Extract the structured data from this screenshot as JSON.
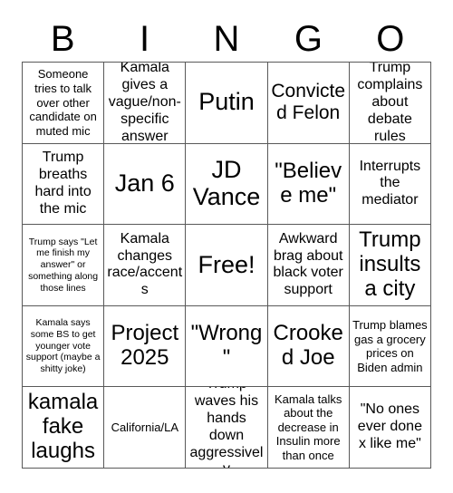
{
  "header": {
    "letters": [
      "B",
      "I",
      "N",
      "G",
      "O"
    ]
  },
  "grid": {
    "rows": 5,
    "columns": 5,
    "border_color": "#595959",
    "background_color": "#ffffff",
    "text_color": "#000000",
    "free_space_index": 12,
    "cells": [
      {
        "text": "Someone tries to talk over other candidate on muted mic",
        "size": "sm"
      },
      {
        "text": "Kamala gives a vague/non-specific answer",
        "size": "md"
      },
      {
        "text": "Putin",
        "size": "xxl"
      },
      {
        "text": "Convicted Felon",
        "size": "lg"
      },
      {
        "text": "Trump complains about debate rules",
        "size": "md"
      },
      {
        "text": "Trump breaths hard into the mic",
        "size": "md"
      },
      {
        "text": "Jan 6",
        "size": "xxl"
      },
      {
        "text": "JD Vance",
        "size": "xxl"
      },
      {
        "text": "\"Believe me\"",
        "size": "xl"
      },
      {
        "text": "Interrupts the mediator",
        "size": "md"
      },
      {
        "text": "Trump says \"Let me finish my answer\" or something along those lines",
        "size": "xs"
      },
      {
        "text": "Kamala changes race/accents",
        "size": "md"
      },
      {
        "text": "Free!",
        "size": "xxl"
      },
      {
        "text": "Awkward brag about black voter support",
        "size": "md"
      },
      {
        "text": "Trump insults a city",
        "size": "xl"
      },
      {
        "text": "Kamala says some BS to get younger vote support (maybe a shitty joke)",
        "size": "xs"
      },
      {
        "text": "Project 2025",
        "size": "xl"
      },
      {
        "text": "\"Wrong\"",
        "size": "xl"
      },
      {
        "text": "Crooked Joe",
        "size": "xl"
      },
      {
        "text": "Trump blames gas a grocery prices on Biden admin",
        "size": "sm"
      },
      {
        "text": "kamala fake laughs",
        "size": "xl"
      },
      {
        "text": "California/LA",
        "size": "sm"
      },
      {
        "text": "Trump waves his hands down aggressively",
        "size": "md"
      },
      {
        "text": "Kamala talks about the decrease in Insulin more than once",
        "size": "sm"
      },
      {
        "text": "\"No ones ever done x like me\"",
        "size": "md"
      }
    ]
  }
}
